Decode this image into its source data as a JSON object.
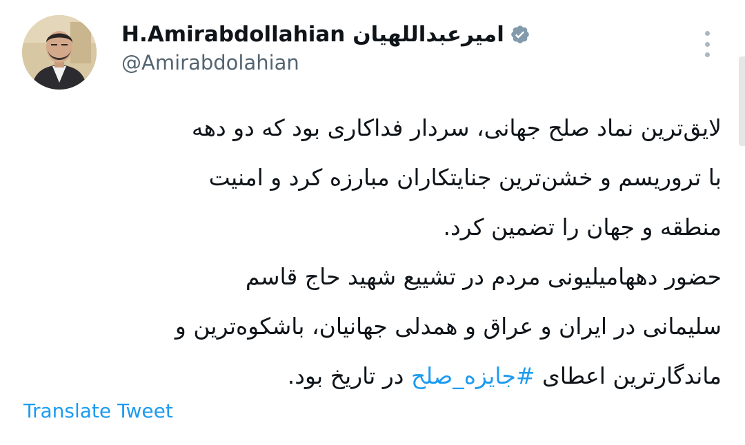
{
  "header": {
    "display_name": "H.Amirabdollahian امیرعبداللهیان",
    "handle": "@Amirabdolahian",
    "verified_icon": "verified-badge-icon",
    "verified_color": "#829aab"
  },
  "tweet": {
    "lines": [
      "لایق‌ترین نماد صلح جهانی، سردار فداکاری بود که دو دهه",
      "با تروریسم و خشن‌ترین جنایتکاران مبارزه کرد و امنیت",
      "منطقه و جهان را تضمین کرد.",
      "حضور دهها‌میلیونی مردم در تشییع شهید حاج قاسم",
      "سلیمانی در ایران و عراق و همدلی جهانیان، باشکوه‌ترین و"
    ],
    "last_line_prefix": "ماندگارترین اعطای",
    "hashtag": "#جایزه_صلح",
    "last_line_suffix": "در تاریخ بود."
  },
  "actions": {
    "translate_label": "Translate Tweet",
    "more_icon": "more-vertical-icon"
  },
  "colors": {
    "text": "#0f1419",
    "secondary": "#536471",
    "link": "#1d9bf0"
  }
}
